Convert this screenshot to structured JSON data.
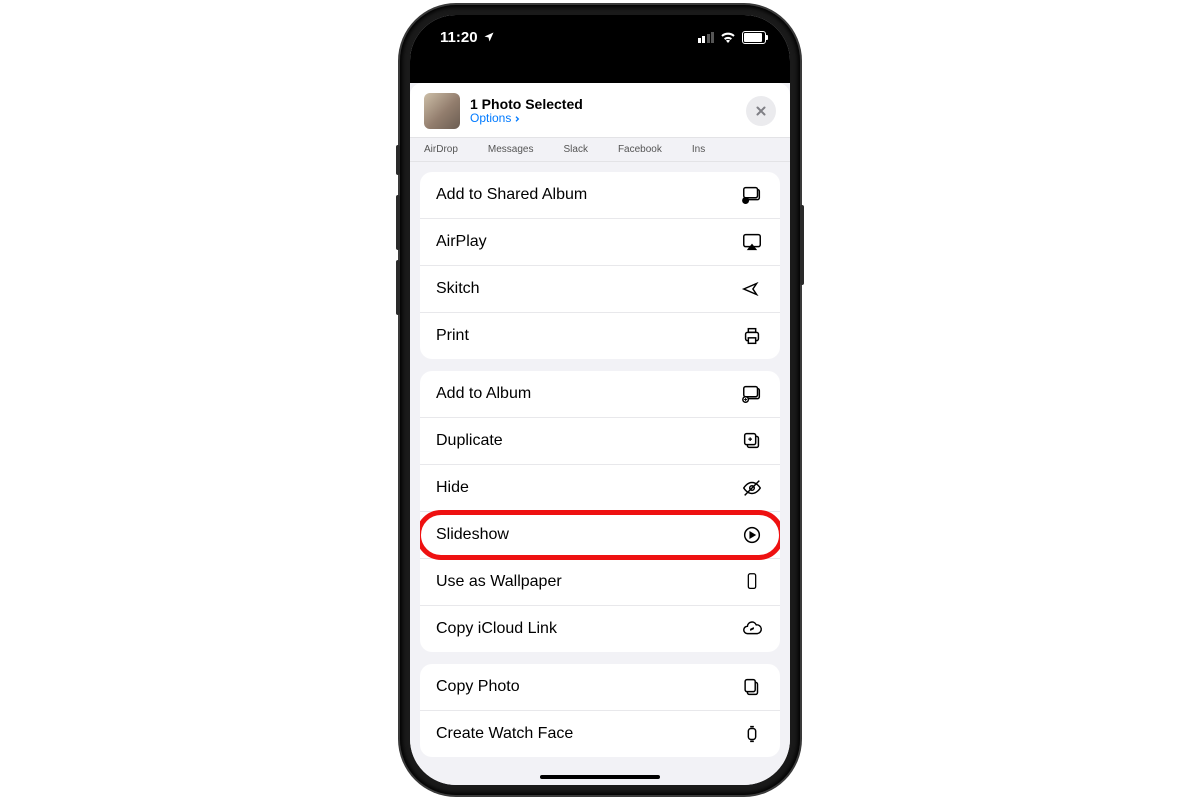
{
  "status": {
    "time": "11:20"
  },
  "header": {
    "title": "1 Photo Selected",
    "options_label": "Options"
  },
  "apps": {
    "a0": "AirDrop",
    "a1": "Messages",
    "a2": "Slack",
    "a3": "Facebook",
    "a4": "Ins"
  },
  "actions": {
    "add_shared_album": "Add to Shared Album",
    "airplay": "AirPlay",
    "skitch": "Skitch",
    "print": "Print",
    "add_album": "Add to Album",
    "duplicate": "Duplicate",
    "hide": "Hide",
    "slideshow": "Slideshow",
    "wallpaper": "Use as Wallpaper",
    "icloud_link": "Copy iCloud Link",
    "copy_photo": "Copy Photo",
    "watch_face": "Create Watch Face"
  }
}
